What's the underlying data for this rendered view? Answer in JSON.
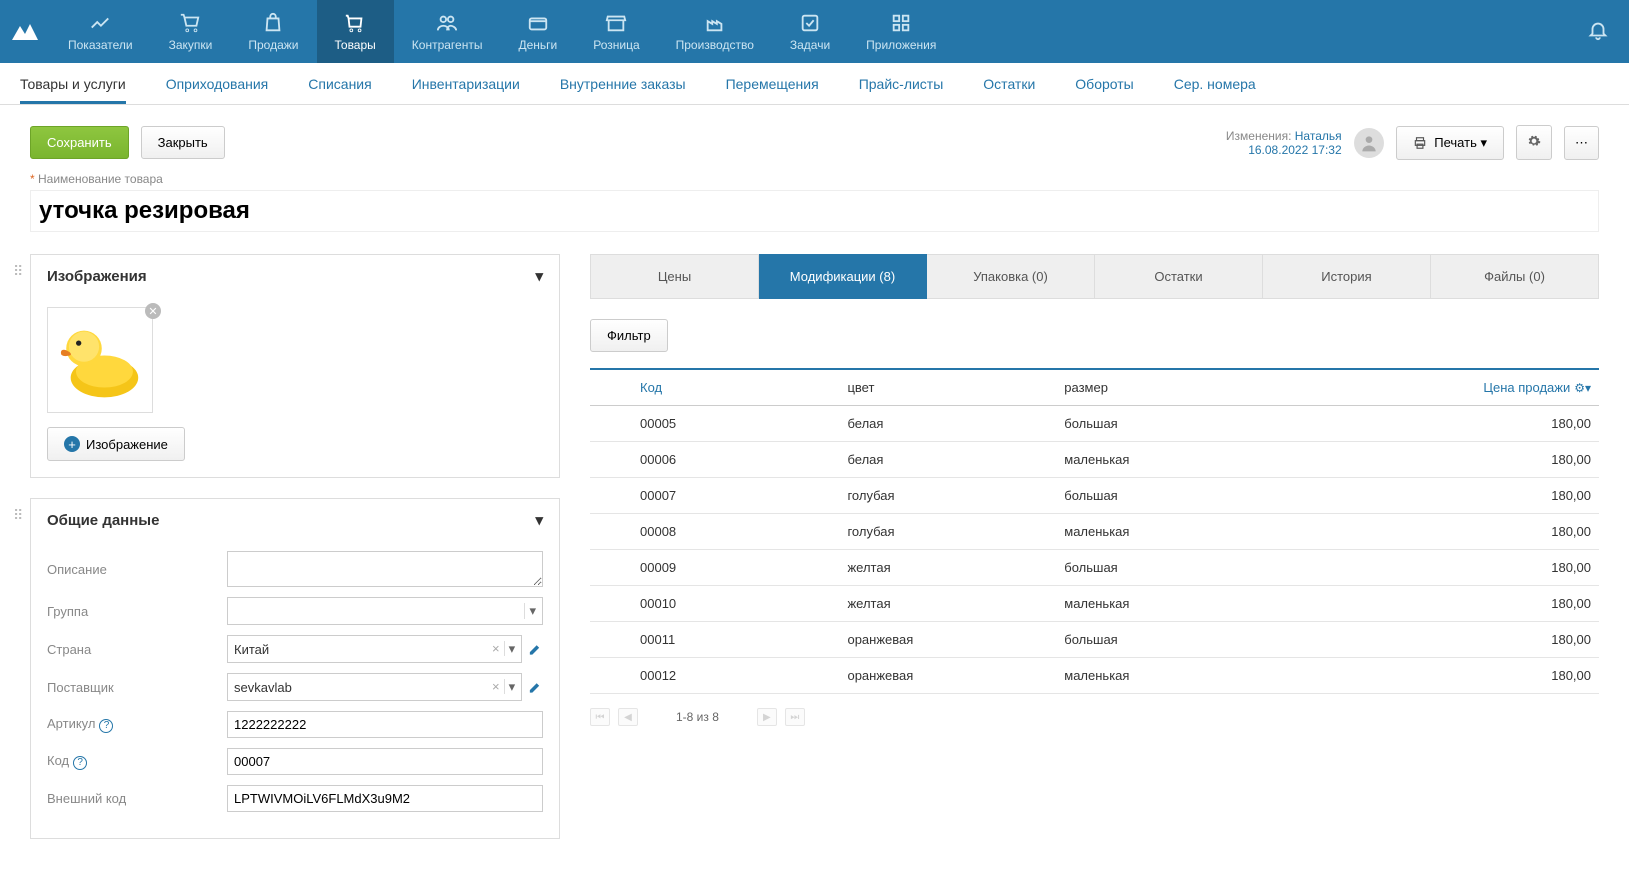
{
  "nav": {
    "items": [
      {
        "label": "Показатели"
      },
      {
        "label": "Закупки"
      },
      {
        "label": "Продажи"
      },
      {
        "label": "Товары"
      },
      {
        "label": "Контрагенты"
      },
      {
        "label": "Деньги"
      },
      {
        "label": "Розница"
      },
      {
        "label": "Производство"
      },
      {
        "label": "Задачи"
      },
      {
        "label": "Приложения"
      }
    ]
  },
  "subnav": {
    "items": [
      "Товары и услуги",
      "Оприходования",
      "Списания",
      "Инвентаризации",
      "Внутренние заказы",
      "Перемещения",
      "Прайс-листы",
      "Остатки",
      "Обороты",
      "Сер. номера"
    ]
  },
  "toolbar": {
    "save": "Сохранить",
    "close": "Закрыть",
    "changed_prefix": "Изменения: ",
    "changed_user": "Наталья",
    "changed_date": "16.08.2022 17:32",
    "print": "Печать"
  },
  "product": {
    "name_label": "Наименование товара",
    "name_value": "уточка резировая"
  },
  "panels": {
    "images": {
      "title": "Изображения",
      "add_button": "Изображение"
    },
    "general": {
      "title": "Общие данные",
      "description_label": "Описание",
      "group_label": "Группа",
      "country_label": "Страна",
      "country_value": "Китай",
      "supplier_label": "Поставщик",
      "supplier_value": "sevkavlab",
      "article_label": "Артикул",
      "article_value": "1222222222",
      "code_label": "Код",
      "code_value": "00007",
      "external_label": "Внешний код",
      "external_value": "LPTWIVMOiLV6FLMdX3u9M2"
    }
  },
  "tabs": {
    "items": [
      "Цены",
      "Модификации (8)",
      "Упаковка (0)",
      "Остатки",
      "История",
      "Файлы (0)"
    ]
  },
  "filter_button": "Фильтр",
  "table": {
    "headers": {
      "code": "Код",
      "color": "цвет",
      "size": "размер",
      "price": "Цена продажи"
    },
    "rows": [
      {
        "code": "00005",
        "color": "белая",
        "size": "большая",
        "price": "180,00"
      },
      {
        "code": "00006",
        "color": "белая",
        "size": "маленькая",
        "price": "180,00"
      },
      {
        "code": "00007",
        "color": "голубая",
        "size": "большая",
        "price": "180,00"
      },
      {
        "code": "00008",
        "color": "голубая",
        "size": "маленькая",
        "price": "180,00"
      },
      {
        "code": "00009",
        "color": "желтая",
        "size": "большая",
        "price": "180,00"
      },
      {
        "code": "00010",
        "color": "желтая",
        "size": "маленькая",
        "price": "180,00"
      },
      {
        "code": "00011",
        "color": "оранжевая",
        "size": "большая",
        "price": "180,00"
      },
      {
        "code": "00012",
        "color": "оранжевая",
        "size": "маленькая",
        "price": "180,00"
      }
    ]
  },
  "pagination": {
    "info": "1-8 из 8"
  }
}
